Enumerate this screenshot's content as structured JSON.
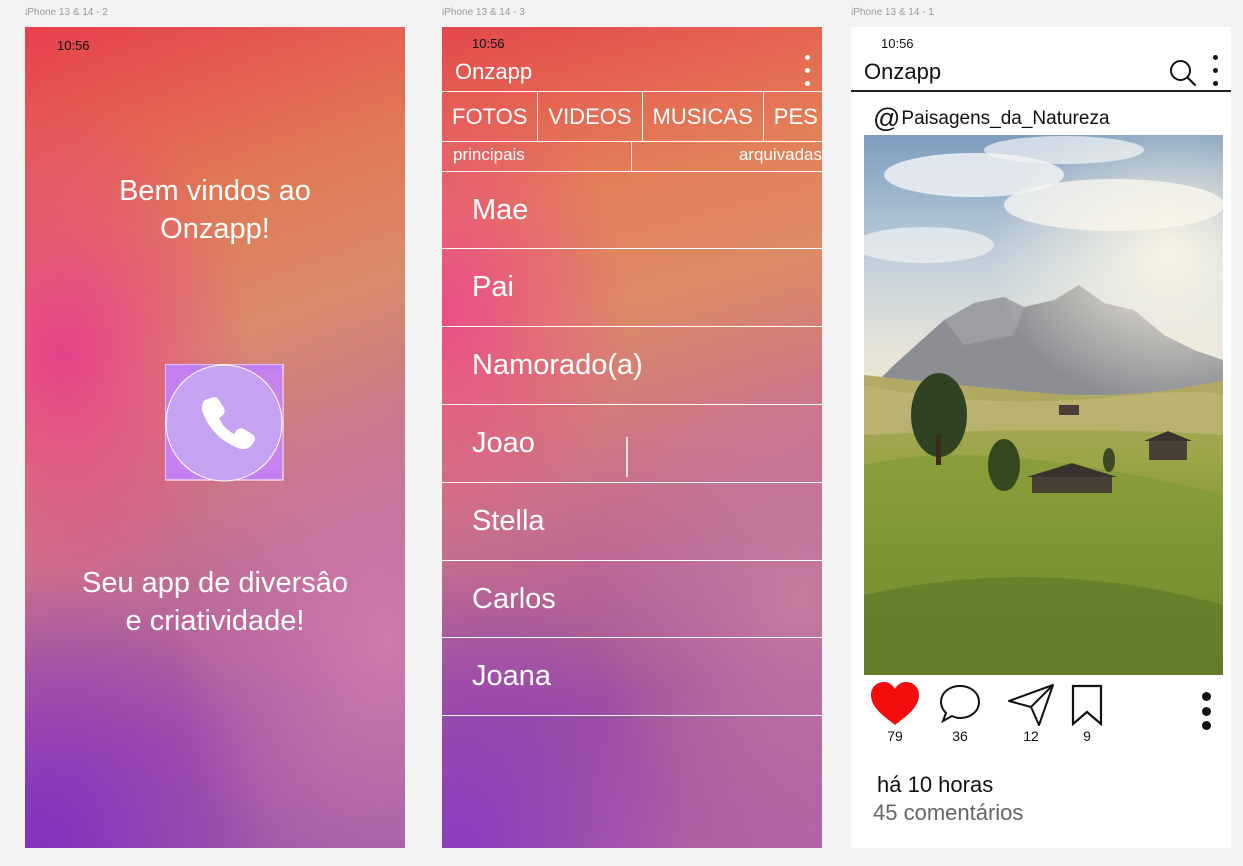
{
  "frames": [
    {
      "label": "iPhone 13 & 14 - 2",
      "time": "10:56",
      "welcome": "Bem vindos ao\nOnzapp!",
      "logo_icon": "phone-icon",
      "tagline": "Seu app de diversâo\ne criatividade!"
    },
    {
      "label": "iPhone 13 & 14 - 3",
      "time": "10:56",
      "app_title": "Onzapp",
      "tabs": [
        "FOTOS",
        "VIDEOS",
        "MUSICAS",
        "PES"
      ],
      "subtabs": [
        "principais",
        "arquivadas"
      ],
      "contacts": [
        "Mae",
        "Pai",
        "Namorado(a)",
        "Joao",
        "Stella",
        "Carlos",
        "Joana"
      ]
    },
    {
      "label": "iPhone 13 & 14 - 1",
      "time": "10:56",
      "app_title": "Onzapp",
      "handle_at": "@",
      "handle": "Paisagens_da_Natureza",
      "likes": "79",
      "comments_count": "36",
      "shares": "12",
      "saves": "9",
      "posted": "há 10 horas",
      "comments_text": "45 comentários"
    }
  ],
  "colors": {
    "like": "#f50d0d",
    "logo_circle": "#c5a3f2",
    "logo_square": "#c37ef0"
  }
}
